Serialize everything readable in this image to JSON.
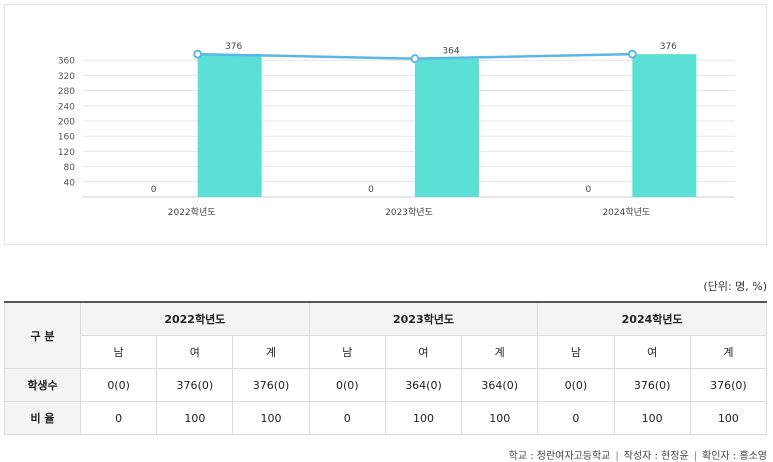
{
  "chart_data": {
    "type": "bar",
    "categories": [
      "2022학년도",
      "2023학년도",
      "2024학년도"
    ],
    "series": [
      {
        "values": [
          0,
          0,
          0
        ],
        "color": "#d9d9d9"
      },
      {
        "values": [
          376,
          364,
          376
        ],
        "color": "#5ce0d6"
      },
      {
        "type": "line",
        "values": [
          376,
          364,
          376
        ],
        "color": "#5ab7e8"
      }
    ],
    "yticks": [
      40,
      80,
      120,
      160,
      200,
      240,
      280,
      320,
      360
    ],
    "ylim": [
      0,
      400
    ],
    "grid": true,
    "title": "",
    "xlabel": "",
    "ylabel": ""
  },
  "unit_label": "(단위: 명, %)",
  "table": {
    "corner_label": "구 분",
    "years": [
      "2022학년도",
      "2023학년도",
      "2024학년도"
    ],
    "subheaders": [
      "남",
      "여",
      "계"
    ],
    "rows": [
      {
        "label": "학생수",
        "cells": [
          "0(0)",
          "376(0)",
          "376(0)",
          "0(0)",
          "364(0)",
          "364(0)",
          "0(0)",
          "376(0)",
          "376(0)"
        ]
      },
      {
        "label": "비 율",
        "cells": [
          "0",
          "100",
          "100",
          "0",
          "100",
          "100",
          "0",
          "100",
          "100"
        ]
      }
    ]
  },
  "footer": {
    "school": "학교 : 청란여자고등학교",
    "author": "작성자 : 현정윤",
    "checker": "확인자 : 홍소영"
  }
}
